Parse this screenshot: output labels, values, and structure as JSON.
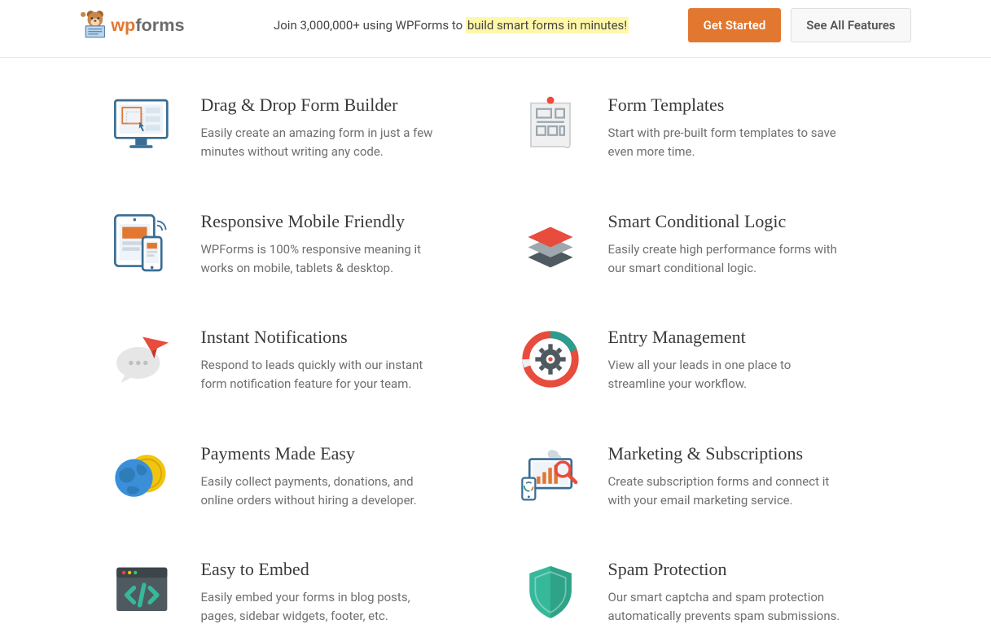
{
  "header": {
    "brand_wp": "wp",
    "brand_forms": "forms",
    "tagline_prefix": "Join 3,000,000+ using WPForms to ",
    "tagline_highlight": "build smart forms in minutes!",
    "cta_primary": "Get Started",
    "cta_secondary": "See All Features"
  },
  "features": [
    {
      "id": "drag-drop",
      "title": "Drag & Drop Form Builder",
      "desc": "Easily create an amazing form in just a few minutes without writing any code."
    },
    {
      "id": "templates",
      "title": "Form Templates",
      "desc": "Start with pre-built form templates to save even more time."
    },
    {
      "id": "responsive",
      "title": "Responsive Mobile Friendly",
      "desc": "WPForms is 100% responsive meaning it works on mobile, tablets & desktop."
    },
    {
      "id": "conditional",
      "title": "Smart Conditional Logic",
      "desc": "Easily create high performance forms with our smart conditional logic."
    },
    {
      "id": "notifications",
      "title": "Instant Notifications",
      "desc": "Respond to leads quickly with our instant form notification feature for your team."
    },
    {
      "id": "entries",
      "title": "Entry Management",
      "desc": "View all your leads in one place to streamline your workflow."
    },
    {
      "id": "payments",
      "title": "Payments Made Easy",
      "desc": "Easily collect payments, donations, and online orders without hiring a developer."
    },
    {
      "id": "marketing",
      "title": "Marketing & Subscriptions",
      "desc": "Create subscription forms and connect it with your email marketing service."
    },
    {
      "id": "embed",
      "title": "Easy to Embed",
      "desc": "Easily embed your forms in blog posts, pages, sidebar widgets, footer, etc."
    },
    {
      "id": "spam",
      "title": "Spam Protection",
      "desc": "Our smart captcha and spam protection automatically prevents spam submissions."
    }
  ]
}
